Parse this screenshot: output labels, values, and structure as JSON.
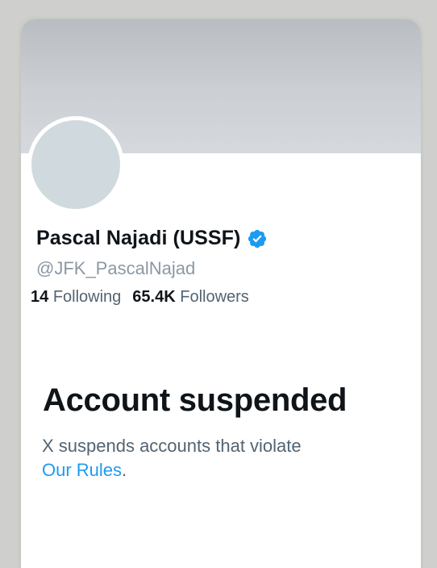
{
  "profile": {
    "name": "Pascal Najadi (USSF)",
    "verified_icon": "verified-badge-icon",
    "handle": "@JFK_PascalNajad",
    "following_count": "14",
    "following_label": "Following",
    "followers_count": "65.4K",
    "followers_label": "Followers"
  },
  "suspension": {
    "title": "Account suspended",
    "description": "X suspends accounts that violate",
    "link_label": "Our Rules",
    "trailing": "."
  },
  "colors": {
    "accent": "#1d9bf0",
    "text_primary": "#0f1419",
    "text_secondary": "#536471",
    "banner": "#ccd0d4",
    "avatar": "#cfd9de"
  }
}
